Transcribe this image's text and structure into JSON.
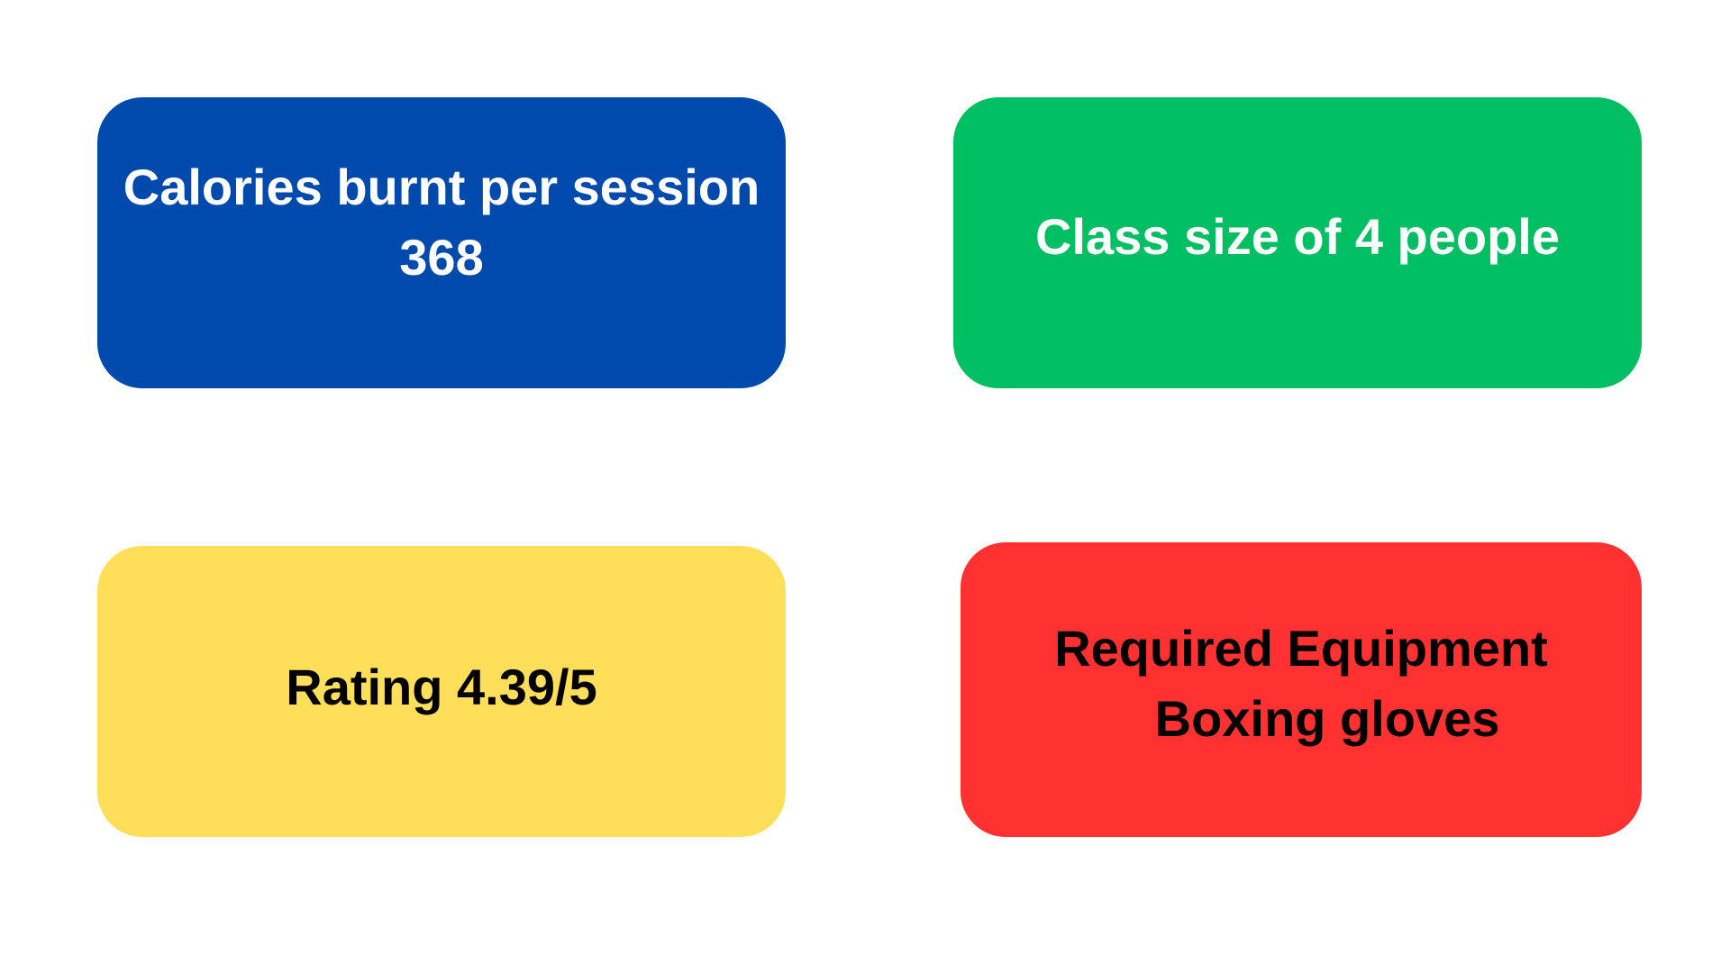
{
  "colors": {
    "background": "#ffffff",
    "blue": "#004aad",
    "green": "#00bf63",
    "yellow": "#ffde59",
    "red": "#ff3131",
    "text_light": "#ffffff",
    "text_dark": "#000000"
  },
  "cards": {
    "calories": {
      "line1": "Calories burnt per session",
      "line2": "368"
    },
    "class_size": {
      "line1": "Class size of 4 people"
    },
    "rating": {
      "line1": "Rating 4.39/5"
    },
    "equipment": {
      "line1": "Required Equipment",
      "line2": "Boxing gloves"
    }
  }
}
